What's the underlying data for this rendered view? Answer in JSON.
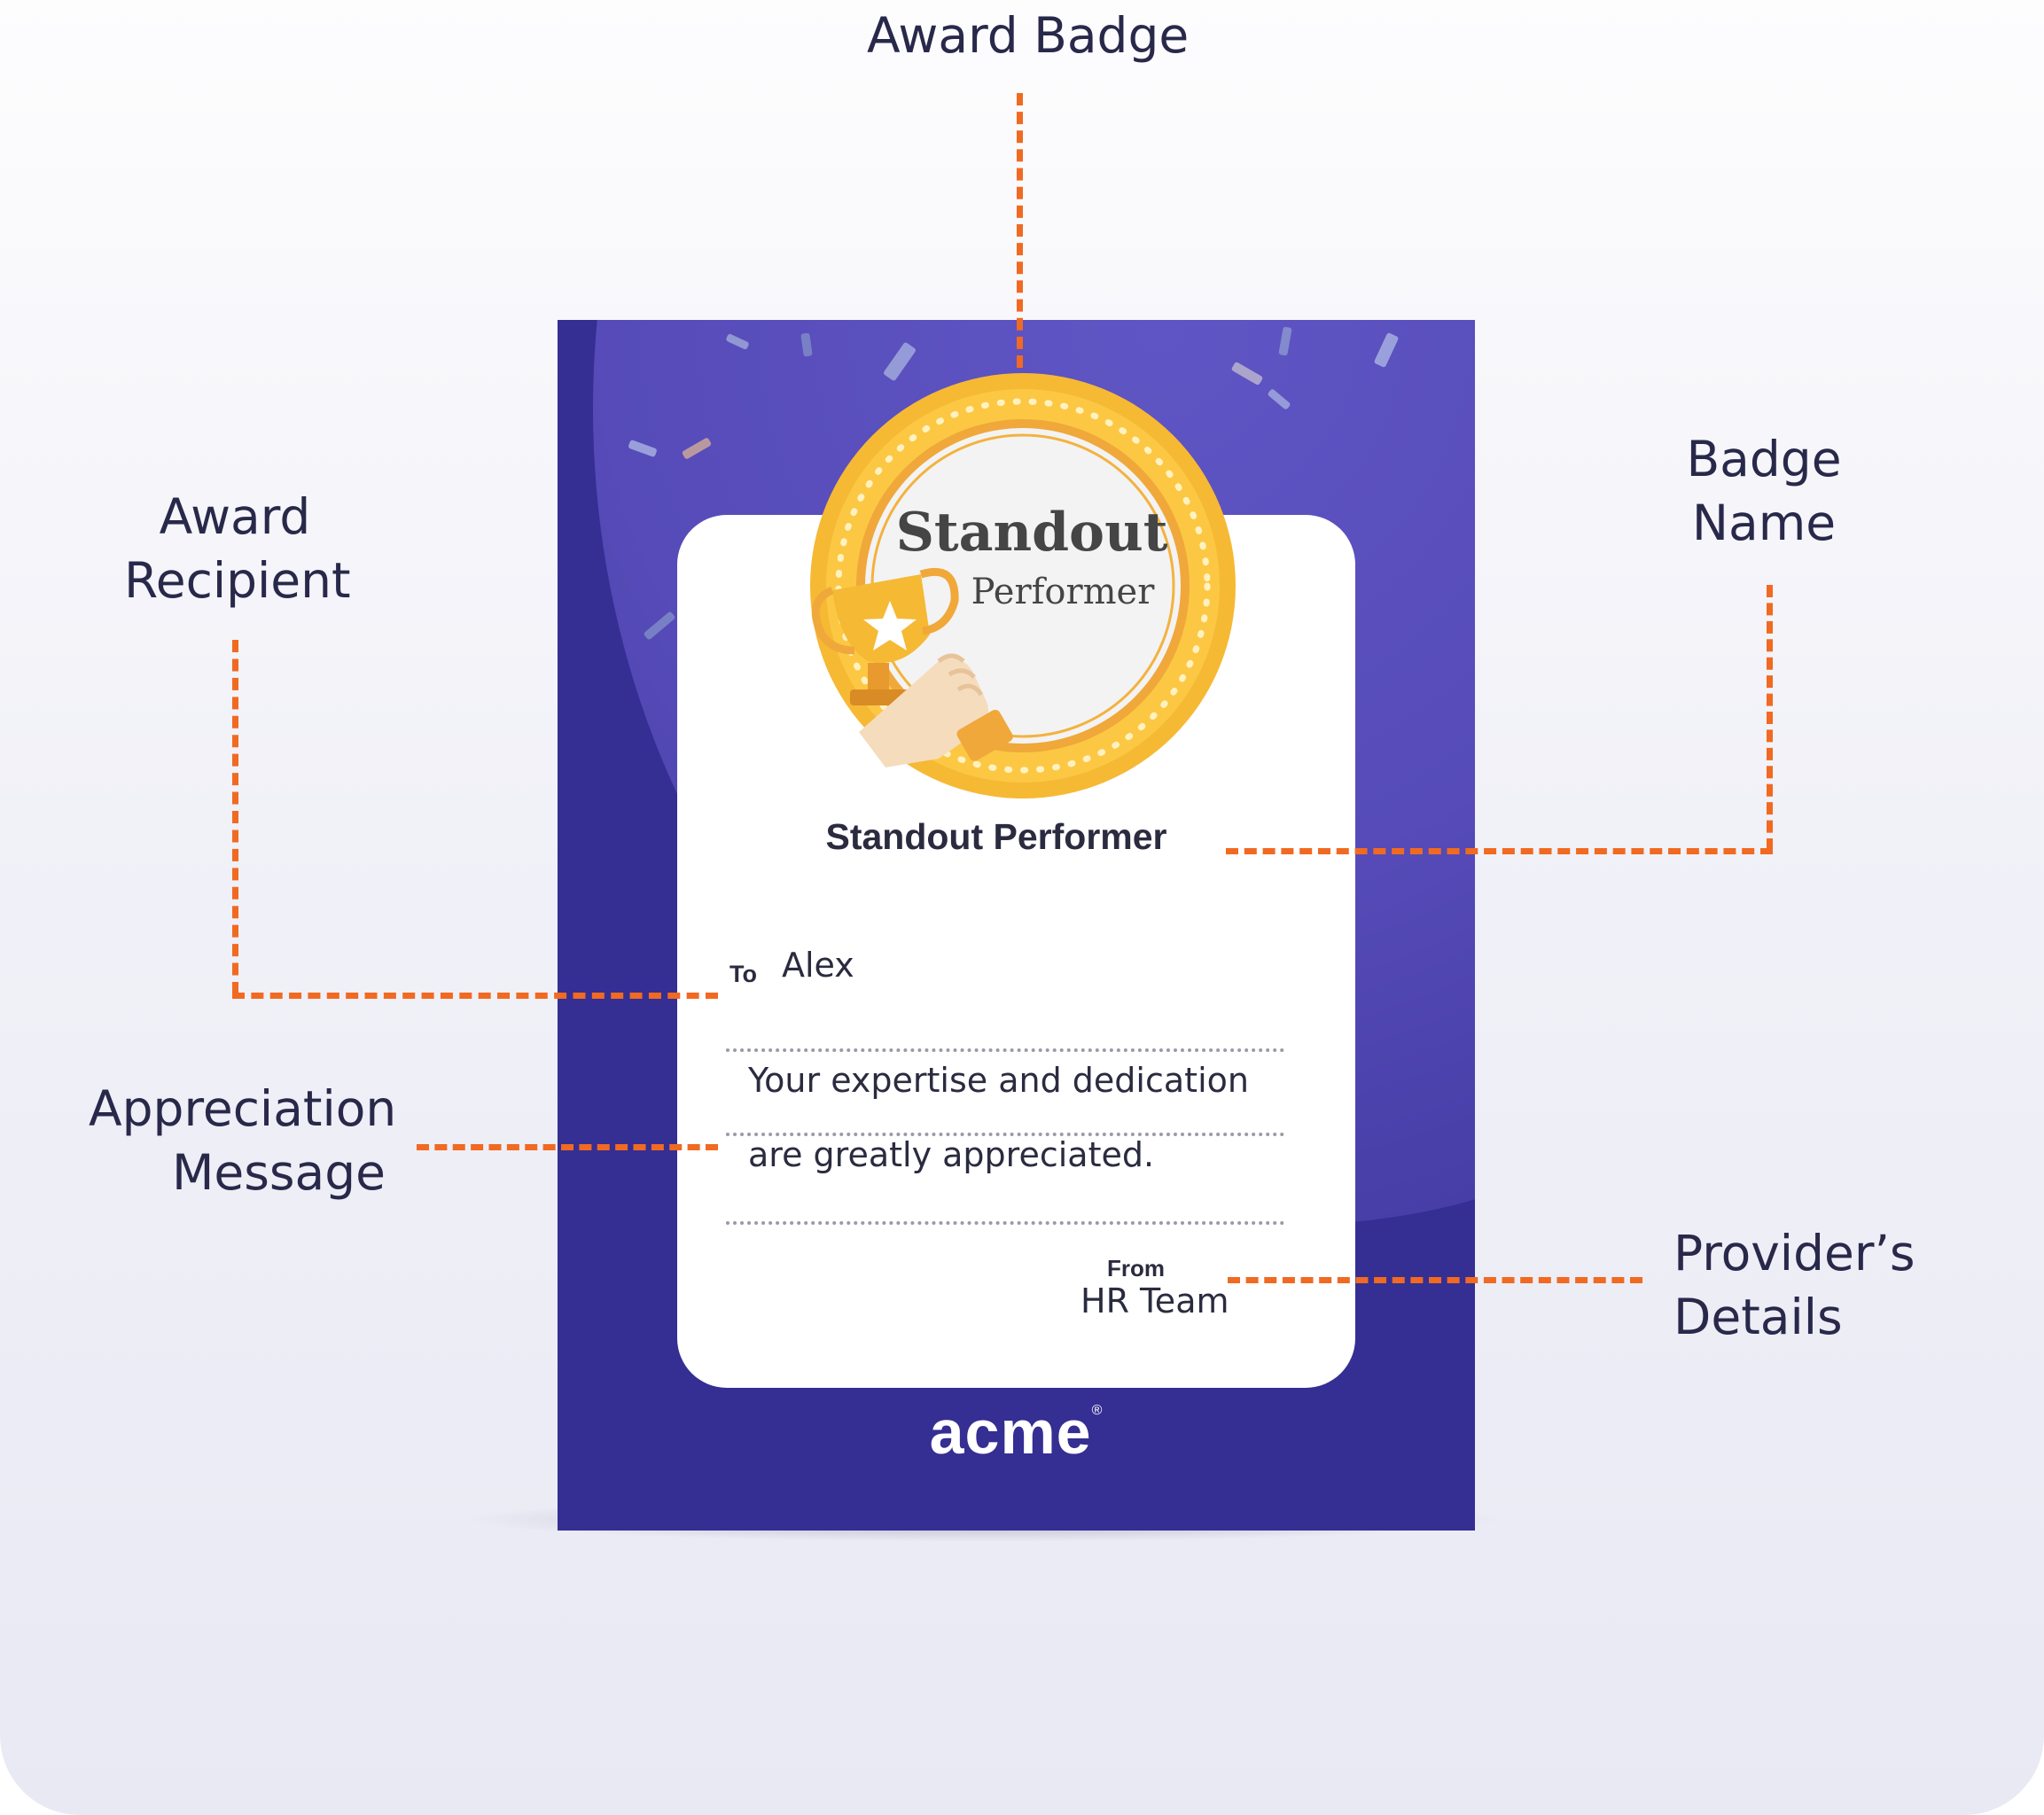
{
  "callouts": {
    "award_badge": "Award Badge",
    "badge_name": [
      "Badge",
      "Name"
    ],
    "award_recipient": [
      "Award",
      "Recipient"
    ],
    "appreciation_message": [
      "Appreciation",
      "Message"
    ],
    "providers_details": [
      "Provider’s",
      "Details"
    ]
  },
  "card": {
    "medal_text": {
      "line1": "Standout",
      "line2": "Performer"
    },
    "badge_name": "Standout Performer",
    "to_label": "To",
    "recipient": "Alex",
    "message_lines": [
      "Your expertise and dedication",
      "are greatly appreciated."
    ],
    "from_label": "From",
    "provider": "HR Team",
    "logo": "acme",
    "logo_mark": "®"
  },
  "colors": {
    "leader": "#f06a22",
    "card_background": "#352e93",
    "medal_gold": "#f5b935",
    "text_dark": "#28294a"
  },
  "icons": [
    "trophy-icon",
    "star-icon",
    "hand-icon",
    "confetti-decoration"
  ]
}
